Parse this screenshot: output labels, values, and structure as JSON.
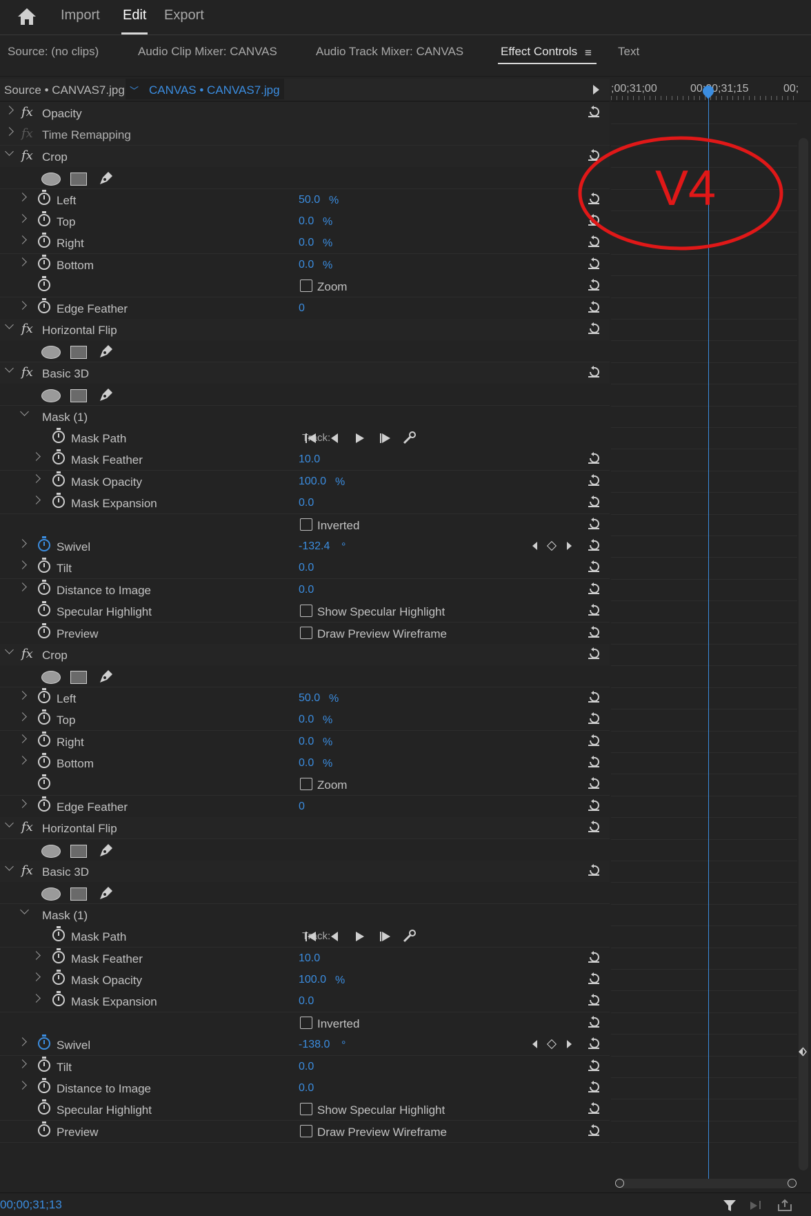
{
  "workspace_tabs": [
    {
      "label": "Import",
      "active": false
    },
    {
      "label": "Edit",
      "active": true
    },
    {
      "label": "Export",
      "active": false
    }
  ],
  "panel_tabs": [
    {
      "label": "Source: (no clips)"
    },
    {
      "label": "Audio Clip Mixer: CANVAS"
    },
    {
      "label": "Audio Track Mixer: CANVAS"
    },
    {
      "label": "Effect Controls",
      "active": true
    },
    {
      "label": "Text"
    }
  ],
  "effect_controls": {
    "source_tab": "Source • CANVAS7.jpg",
    "clip_tab": "CANVAS • CANVAS7.jpg"
  },
  "timeline": {
    "ticks": [
      ";00;31;00",
      "00;00;31;15",
      "00;"
    ],
    "annotation": "V4"
  },
  "current_timecode": "00;00;31;13",
  "rows": [
    {
      "kind": "fx",
      "name": "Opacity",
      "expanded": false
    },
    {
      "kind": "fx",
      "name": "Time Remapping",
      "expanded": false,
      "dim": true
    },
    {
      "kind": "fx",
      "name": "Crop",
      "expanded": true
    },
    {
      "kind": "shapes"
    },
    {
      "kind": "param",
      "name": "Left",
      "value": "50.0",
      "unit": "%"
    },
    {
      "kind": "param",
      "name": "Top",
      "value": "0.0",
      "unit": "%"
    },
    {
      "kind": "param",
      "name": "Right",
      "value": "0.0",
      "unit": "%"
    },
    {
      "kind": "param",
      "name": "Bottom",
      "value": "0.0",
      "unit": "%"
    },
    {
      "kind": "check",
      "name": "",
      "label": "Zoom"
    },
    {
      "kind": "param",
      "name": "Edge Feather",
      "value": "0",
      "unit": ""
    },
    {
      "kind": "fx",
      "name": "Horizontal Flip",
      "expanded": true
    },
    {
      "kind": "shapes"
    },
    {
      "kind": "fx",
      "name": "Basic 3D",
      "expanded": true
    },
    {
      "kind": "shapes"
    },
    {
      "kind": "mask",
      "name": "Mask (1)"
    },
    {
      "kind": "maskpath",
      "name": "Mask Path",
      "track_label": "Track:"
    },
    {
      "kind": "maskparam",
      "name": "Mask Feather",
      "value": "10.0",
      "unit": ""
    },
    {
      "kind": "maskparam",
      "name": "Mask Opacity",
      "value": "100.0",
      "unit": "%"
    },
    {
      "kind": "maskparam",
      "name": "Mask Expansion",
      "value": "0.0",
      "unit": ""
    },
    {
      "kind": "check",
      "name": "",
      "label": "Inverted",
      "nowatch": true
    },
    {
      "kind": "param",
      "name": "Swivel",
      "value": "-132.4",
      "unit": "°",
      "animated": true
    },
    {
      "kind": "param",
      "name": "Tilt",
      "value": "0.0",
      "unit": ""
    },
    {
      "kind": "param",
      "name": "Distance to Image",
      "value": "0.0",
      "unit": ""
    },
    {
      "kind": "check",
      "name": "Specular Highlight",
      "label": "Show Specular Highlight"
    },
    {
      "kind": "check",
      "name": "Preview",
      "label": "Draw Preview Wireframe"
    },
    {
      "kind": "fx",
      "name": "Crop",
      "expanded": true
    },
    {
      "kind": "shapes"
    },
    {
      "kind": "param",
      "name": "Left",
      "value": "50.0",
      "unit": "%"
    },
    {
      "kind": "param",
      "name": "Top",
      "value": "0.0",
      "unit": "%"
    },
    {
      "kind": "param",
      "name": "Right",
      "value": "0.0",
      "unit": "%"
    },
    {
      "kind": "param",
      "name": "Bottom",
      "value": "0.0",
      "unit": "%"
    },
    {
      "kind": "check",
      "name": "",
      "label": "Zoom"
    },
    {
      "kind": "param",
      "name": "Edge Feather",
      "value": "0",
      "unit": ""
    },
    {
      "kind": "fx",
      "name": "Horizontal Flip",
      "expanded": true
    },
    {
      "kind": "shapes"
    },
    {
      "kind": "fx",
      "name": "Basic 3D",
      "expanded": true
    },
    {
      "kind": "shapes"
    },
    {
      "kind": "mask",
      "name": "Mask (1)"
    },
    {
      "kind": "maskpath",
      "name": "Mask Path",
      "track_label": "Track:"
    },
    {
      "kind": "maskparam",
      "name": "Mask Feather",
      "value": "10.0",
      "unit": ""
    },
    {
      "kind": "maskparam",
      "name": "Mask Opacity",
      "value": "100.0",
      "unit": "%"
    },
    {
      "kind": "maskparam",
      "name": "Mask Expansion",
      "value": "0.0",
      "unit": ""
    },
    {
      "kind": "check",
      "name": "",
      "label": "Inverted",
      "nowatch": true
    },
    {
      "kind": "param",
      "name": "Swivel",
      "value": "-138.0",
      "unit": "°",
      "animated": true
    },
    {
      "kind": "param",
      "name": "Tilt",
      "value": "0.0",
      "unit": ""
    },
    {
      "kind": "param",
      "name": "Distance to Image",
      "value": "0.0",
      "unit": ""
    },
    {
      "kind": "check",
      "name": "Specular Highlight",
      "label": "Show Specular Highlight"
    },
    {
      "kind": "check",
      "name": "Preview",
      "label": "Draw Preview Wireframe"
    }
  ],
  "colors": {
    "accent": "#3b8de0",
    "annotation": "#e01818",
    "background": "#232323"
  }
}
